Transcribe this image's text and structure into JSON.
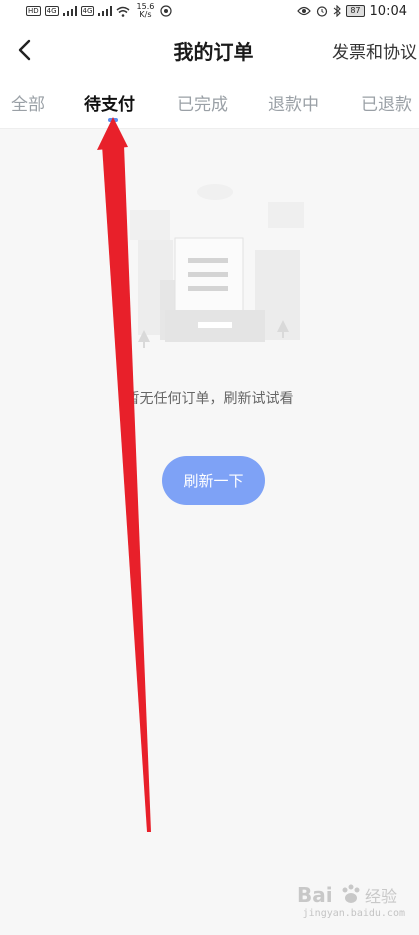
{
  "status_bar": {
    "sim1": "HD",
    "sim2": "HD",
    "net1": "4G",
    "net2": "4G",
    "speed_value": "15.6",
    "speed_unit": "K/s",
    "battery": "87",
    "time": "10:04"
  },
  "nav": {
    "title": "我的订单",
    "right_link": "发票和协议"
  },
  "tabs": [
    {
      "label": "全部",
      "active": false
    },
    {
      "label": "待支付",
      "active": true
    },
    {
      "label": "已完成",
      "active": false
    },
    {
      "label": "退款中",
      "active": false
    },
    {
      "label": "已退款",
      "active": false
    }
  ],
  "empty": {
    "message": "暂无任何订单，刷新试试看",
    "button_label": "刷新一下"
  },
  "annotation": {
    "color": "#e8202a"
  },
  "watermark": {
    "sub": "jingyan.baidu.com"
  },
  "colors": {
    "accent": "#5b8def",
    "button": "#7ea2f6",
    "background": "#f7f7f7"
  }
}
